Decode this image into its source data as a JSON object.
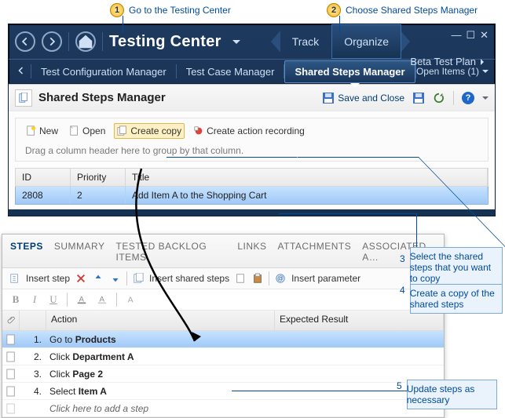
{
  "callouts": {
    "c1": "Go to the Testing Center",
    "c2": "Choose Shared Steps Manager",
    "c3": "Select the shared steps that you want to copy",
    "c4": "Create a copy of the shared steps",
    "c5": "Update steps as necessary"
  },
  "app": {
    "title": "Testing Center",
    "tabs": {
      "track": "Track",
      "organize": "Organize"
    },
    "beta_plan": "Beta Test Plan",
    "subnav": {
      "tcm": "Test Configuration Manager",
      "tcase": "Test Case Manager",
      "ssm": "Shared Steps Manager",
      "open_items": "Open Items (1)"
    }
  },
  "panel": {
    "title": "Shared Steps Manager",
    "save_close": "Save and Close"
  },
  "toolbar": {
    "new": "New",
    "open": "Open",
    "create_copy": "Create copy",
    "create_action": "Create action recording"
  },
  "group_hint": "Drag a column header here to group by that column.",
  "grid": {
    "cols": {
      "id": "ID",
      "priority": "Priority",
      "title": "Title"
    },
    "row": {
      "id": "2808",
      "priority": "2",
      "title": "Add Item A to the Shopping Cart"
    }
  },
  "steps_tabs": {
    "steps": "STEPS",
    "summary": "SUMMARY",
    "tested": "TESTED BACKLOG ITEMS",
    "links": "LINKS",
    "attach": "ATTACHMENTS",
    "assoc": "ASSOCIATED A…"
  },
  "steps_toolbar": {
    "insert_step": "Insert step",
    "insert_shared": "Insert shared steps",
    "insert_param": "Insert parameter"
  },
  "steps_grid": {
    "cols": {
      "action": "Action",
      "expected": "Expected Result"
    },
    "rows": [
      {
        "n": "1.",
        "pre": "Go to ",
        "bold": "Products"
      },
      {
        "n": "2.",
        "pre": "Click ",
        "bold": "Department A"
      },
      {
        "n": "3.",
        "pre": "Click ",
        "bold": "Page 2"
      },
      {
        "n": "4.",
        "pre": "Select ",
        "bold": "Item A"
      }
    ],
    "add_step": "Click here to add a step"
  }
}
